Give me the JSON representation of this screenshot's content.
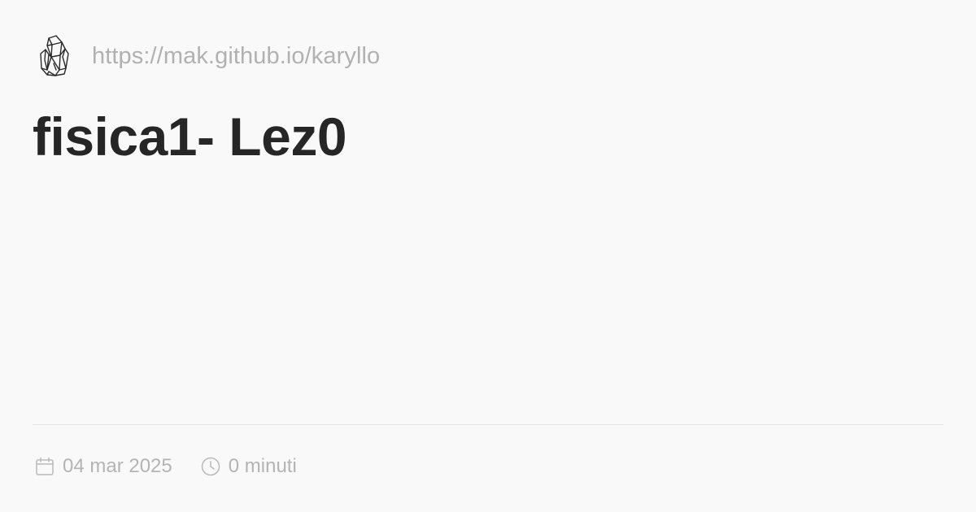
{
  "header": {
    "logo_icon": "crystal-logo-icon",
    "site_url": "https://mak.github.io/karyllo"
  },
  "post": {
    "title": "fisica1- Lez0"
  },
  "meta": {
    "date_icon": "calendar-icon",
    "date": "04 mar 2025",
    "reading_time_icon": "clock-icon",
    "reading_time": "0 minuti"
  },
  "colors": {
    "background": "#faf9fa",
    "title": "#262626",
    "muted_text": "#b1b1b1",
    "divider": "#e4e4e4"
  }
}
